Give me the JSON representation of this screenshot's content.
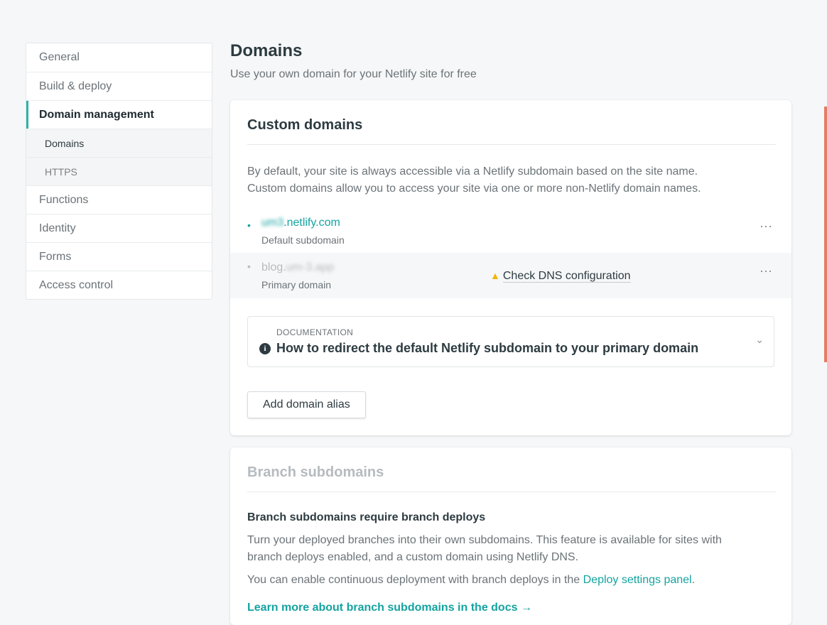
{
  "sidebar": {
    "items": [
      {
        "label": "General"
      },
      {
        "label": "Build & deploy"
      },
      {
        "label": "Domain management"
      },
      {
        "label": "Domains"
      },
      {
        "label": "HTTPS"
      },
      {
        "label": "Functions"
      },
      {
        "label": "Identity"
      },
      {
        "label": "Forms"
      },
      {
        "label": "Access control"
      }
    ]
  },
  "header": {
    "title": "Domains",
    "subtitle": "Use your own domain for your Netlify site for free"
  },
  "custom_domains": {
    "title": "Custom domains",
    "description_1": "By default, your site is always accessible via a Netlify subdomain based on the site name.",
    "description_2": "Custom domains allow you to access your site via one or more non-Netlify domain names.",
    "domains": [
      {
        "name_blurred": "um3",
        "name_visible": ".netlify.com",
        "label": "Default subdomain",
        "color": "#14a3a0"
      },
      {
        "name_visible": "blog.",
        "name_blurred": "um-3.app",
        "label": "Primary domain",
        "status": "Check DNS configuration",
        "color": "#b5bbbf"
      }
    ],
    "more_icon": "⋯",
    "doc": {
      "kicker": "DOCUMENTATION",
      "title": "How to redirect the default Netlify subdomain to your primary domain",
      "info_icon": "i",
      "chevron": "⌄"
    },
    "add_button": "Add domain alias"
  },
  "branch_subdomains": {
    "title": "Branch subdomains",
    "heading": "Branch subdomains require branch deploys",
    "description_1": "Turn your deployed branches into their own subdomains. This feature is available for sites with",
    "description_2": "branch deploys enabled, and a custom domain using Netlify DNS.",
    "enable_prefix": "You can enable continuous deployment with branch deploys in the ",
    "enable_link": "Deploy settings panel",
    "enable_suffix": ".",
    "learn_more": "Learn more about branch subdomains in the docs →"
  },
  "colors": {
    "accent": "#14a3a0",
    "active_border": "#2bb2a8",
    "warning": "#f5b301"
  }
}
